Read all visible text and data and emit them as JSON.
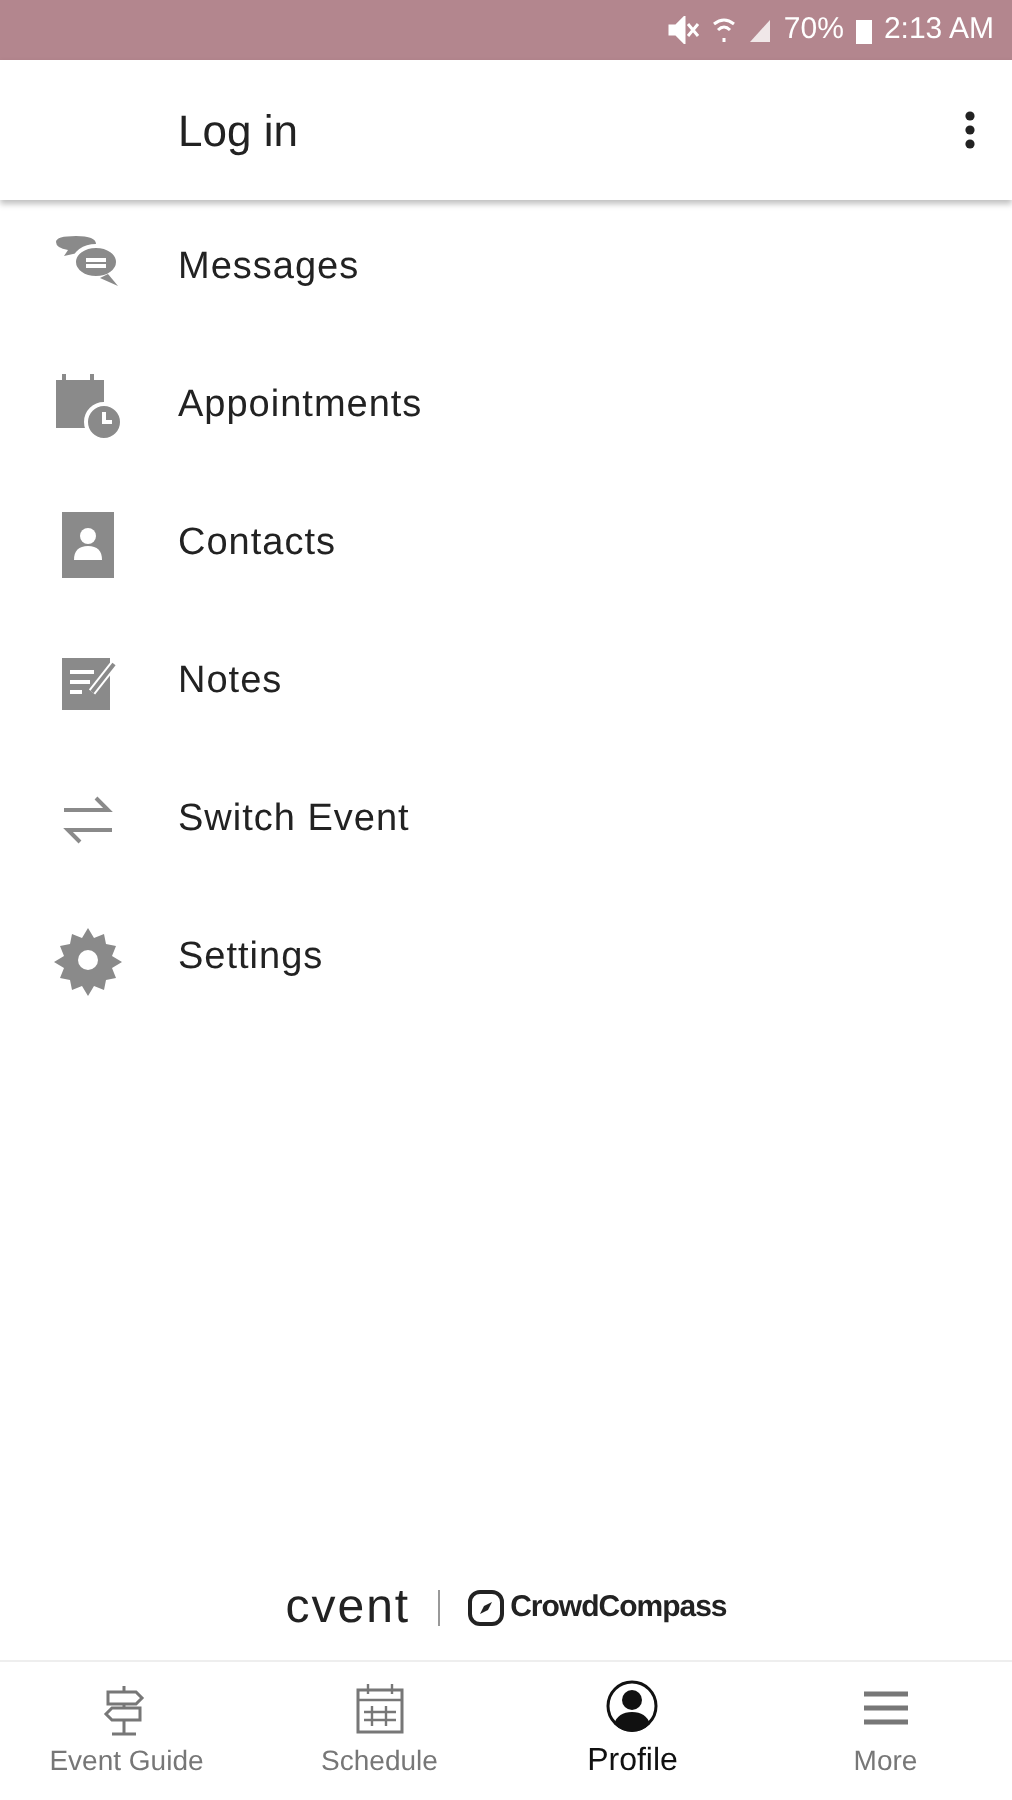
{
  "status_bar": {
    "battery": "70%",
    "time": "2:13 AM"
  },
  "header": {
    "title": "Log in"
  },
  "menu": [
    {
      "label": "Messages"
    },
    {
      "label": "Appointments"
    },
    {
      "label": "Contacts"
    },
    {
      "label": "Notes"
    },
    {
      "label": "Switch Event"
    },
    {
      "label": "Settings"
    }
  ],
  "footer": {
    "brand": "cvent",
    "partner": "CrowdCompass"
  },
  "tabs": [
    {
      "label": "Event Guide",
      "selected": false
    },
    {
      "label": "Schedule",
      "selected": false
    },
    {
      "label": "Profile",
      "selected": true
    },
    {
      "label": "More",
      "selected": false
    }
  ]
}
